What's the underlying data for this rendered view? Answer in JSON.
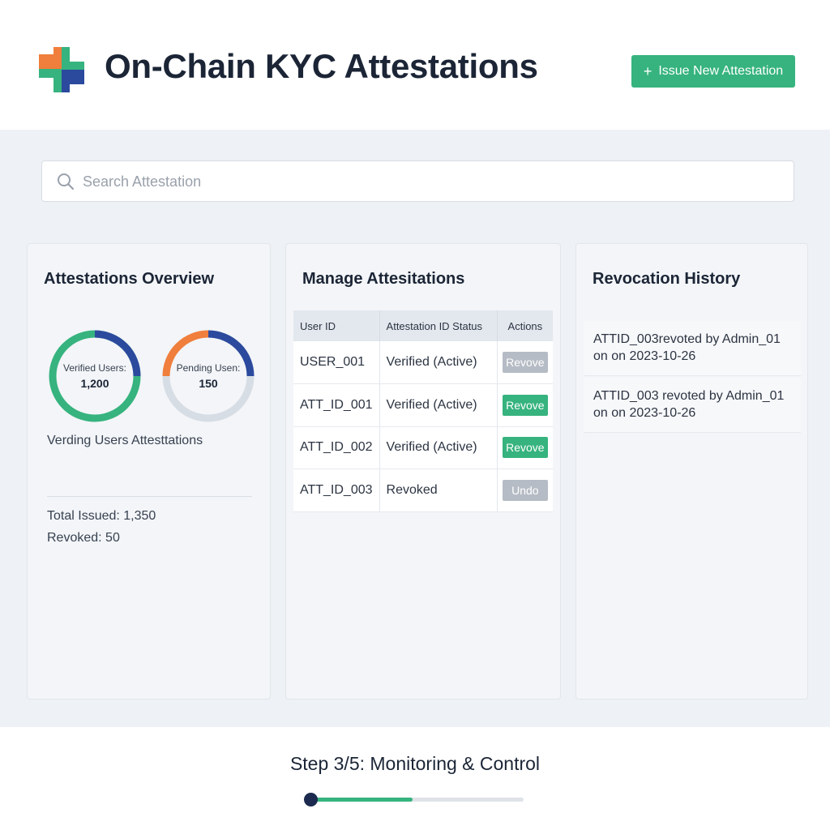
{
  "header": {
    "title": "On-Chain KYC Attestations",
    "issue_button": {
      "icon": "plus-icon",
      "label": "Issue New Attestation"
    },
    "logo_colors": {
      "orange": "#f07e3c",
      "green": "#36b37e",
      "blue": "#2b4a9e"
    }
  },
  "search": {
    "placeholder": "Search Attestation",
    "icon": "search-icon"
  },
  "overview": {
    "title": "Attestations Overview",
    "donuts": [
      {
        "label": "Verified Users:",
        "value": "1,200",
        "fraction": 0.25,
        "segment_color": "#2b4a9e",
        "base_color": "#36b37e"
      },
      {
        "label": "Pending Usen:",
        "value": "150",
        "fraction": 0.25,
        "segment_color": "#2b4a9e",
        "accent_color": "#f07e3c",
        "base_color": "#d7dde5"
      }
    ],
    "legend_text": "Verding Users Attesttations",
    "total_issued": "Total Issued: 1,350",
    "revoked": "Revoked: 50"
  },
  "manage": {
    "title": "Manage Attesitations",
    "columns": [
      "User ID",
      "Attestation ID  Status",
      "Actions"
    ],
    "rows": [
      {
        "id": "USER_001",
        "status": "Verified (Active)",
        "action": "Revove",
        "action_style": "disabled"
      },
      {
        "id": "ATT_ID_001",
        "status": "Verified (Active)",
        "action": "Revove",
        "action_style": "primary"
      },
      {
        "id": "ATT_ID_002",
        "status": "Verified (Active)",
        "action": "Revove",
        "action_style": "primary"
      },
      {
        "id": "ATT_ID_003",
        "status": "Revoked",
        "action": "Undo",
        "action_style": "disabled"
      }
    ]
  },
  "history": {
    "title": "Revocation History",
    "items": [
      {
        "text": "ATTID_003revoted by Admin_01 on on 2023-10-26"
      },
      {
        "text": "ATTID_003 revoted by Admin_01 on on 2023-10-26"
      }
    ]
  },
  "footer": {
    "step_text": "Step 3/5: Monitoring & Control",
    "progress_fraction": 0.48
  }
}
